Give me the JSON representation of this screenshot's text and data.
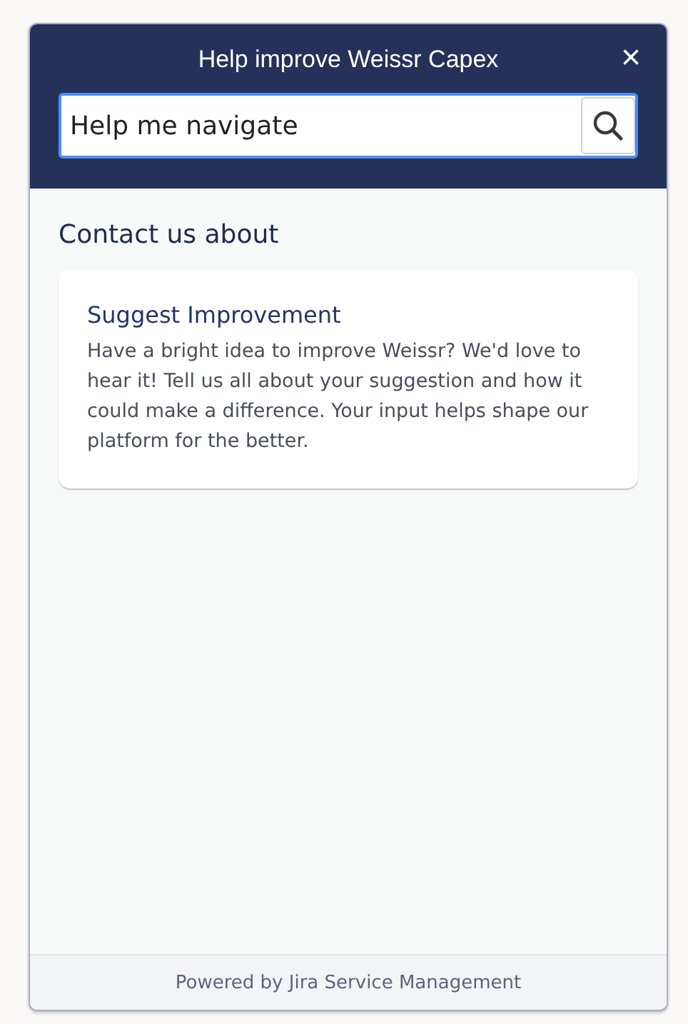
{
  "header": {
    "title": "Help improve Weissr Capex",
    "close": "×"
  },
  "search": {
    "value": "Help me navigate"
  },
  "section": {
    "title": "Contact us about",
    "cards": [
      {
        "title": "Suggest Improvement",
        "description": "Have a bright idea to improve Weissr? We'd love to hear it! Tell us all about your suggestion and how it could make a difference. Your input helps shape our platform for the better."
      }
    ]
  },
  "footer": {
    "text": "Powered by Jira Service Management"
  }
}
